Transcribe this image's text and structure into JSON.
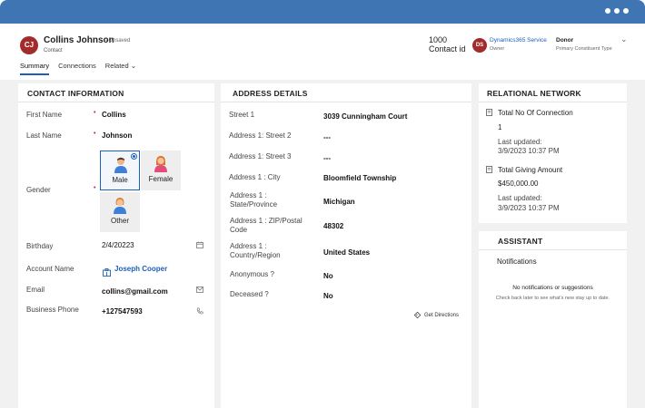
{
  "header": {
    "avatar_initials": "CJ",
    "name": "Collins Johnson",
    "unsaved": "- Unsaved",
    "entity": "Contact",
    "contact_number": "1000",
    "contact_id_label": "Contact id",
    "owner_initials": "DS",
    "owner_name": "Dynamics365 Service",
    "owner_label": "Owner",
    "type_value": "Donor",
    "type_label": "Primary Constituent Type"
  },
  "tabs": [
    {
      "label": "Summary",
      "active": true
    },
    {
      "label": "Connections"
    },
    {
      "label": "Related"
    }
  ],
  "contact_info": {
    "title": "CONTACT INFORMATION",
    "first_name_label": "First Name",
    "first_name": "Collins",
    "last_name_label": "Last Name",
    "last_name": "Johnson",
    "gender_label": "Gender",
    "gender_options": [
      "Male",
      "Female",
      "Other"
    ],
    "gender_selected": "Male",
    "birthday_label": "Birthday",
    "birthday": "2/4/20223",
    "account_label": "Account Name",
    "account": "Joseph Cooper",
    "email_label": "Email",
    "email": "collins@gmail.com",
    "phone_label": "Business Phone",
    "phone": "+127547593"
  },
  "address": {
    "title": "ADDRESS DETAILS",
    "rows": [
      {
        "label": "Street 1",
        "value": "3039 Cunningham Court"
      },
      {
        "label": "Address 1: Street 2",
        "value": "---"
      },
      {
        "label": "Address 1: Street 3",
        "value": "---"
      },
      {
        "label": "Address 1 : City",
        "value": "Bloomfield Township"
      },
      {
        "label": "Address 1 : State/Province",
        "value": "Michigan"
      },
      {
        "label": "Address 1 : ZIP/Postal Code",
        "value": "48302"
      },
      {
        "label": "Address 1 : Country/Region",
        "value": "United States"
      },
      {
        "label": "Anonymous ?",
        "value": "No"
      },
      {
        "label": "Deceased ?",
        "value": "No"
      }
    ],
    "directions": "Get Directions"
  },
  "relational": {
    "title": "RELATIONAL NETWORK",
    "items": [
      {
        "title": "Total No Of Connection",
        "value": "1",
        "updated_label": "Last updated:",
        "updated": "3/9/2023 10:37 PM"
      },
      {
        "title": "Total Giving Amount",
        "value": "$450,000.00",
        "updated_label": "Last updated:",
        "updated": "3/9/2023 10:37 PM"
      }
    ]
  },
  "assistant": {
    "title": "ASSISTANT",
    "notifications_label": "Notifications",
    "empty_title": "No notifications or suggestions",
    "empty_sub": "Check back later to see what's new stay up to date."
  }
}
